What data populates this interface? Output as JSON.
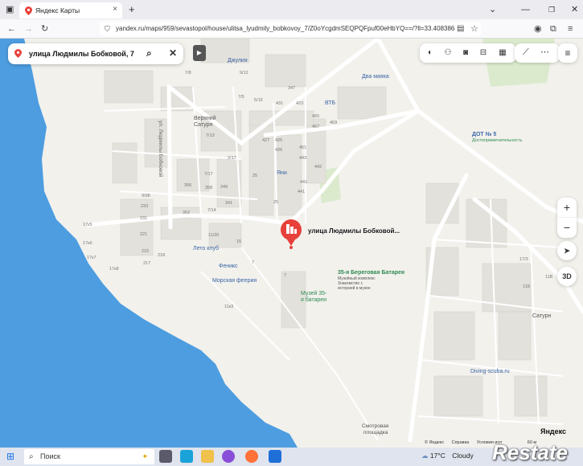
{
  "browser": {
    "tab_title": "Яндекс Карты",
    "new_tab": "+",
    "url": "yandex.ru/maps/959/sevastopol/house/ulitsa_lyudmily_bobkovoy_7/Z0oYcgdmSEQPQFpuf00eHbYQ==/?ll=33.408386",
    "window_controls": [
      "⌄",
      "—",
      "❐",
      "✕"
    ]
  },
  "search": {
    "query": "улица Людмилы Бобковой, 7",
    "pin_color": "#e8403a"
  },
  "map": {
    "selected_address": "улица Людмилы Бобковой...",
    "street_label": "ул. Людмилы Бобковой",
    "districts": [
      "Верхний",
      "Сатурн"
    ],
    "district_right": "Сатурн",
    "pois": [
      {
        "name": "Джулия"
      },
      {
        "name": "Два маяка"
      },
      {
        "name": "ВТБ"
      },
      {
        "name": "Яни"
      },
      {
        "name": "Лето клуб"
      },
      {
        "name": "Феникс"
      },
      {
        "name": "Морская феерия"
      },
      {
        "name": "ДОТ № 5",
        "sub": "Достопримечательность"
      },
      {
        "name": "35-я Береговая Батарея",
        "sub1": "Музейный комплекс",
        "sub2": "Знакомство с",
        "sub3": "историей в музее"
      },
      {
        "name": "Музей 35-",
        "name2": "я батареи"
      },
      {
        "name": "Diving-scuba.ru"
      },
      {
        "name": "Смотровая",
        "name2": "площадка"
      }
    ],
    "house_numbers": [
      "7/8",
      "9/12",
      "347",
      "431",
      "7/5",
      "423",
      "5/15",
      "465",
      "467",
      "469",
      "7/13",
      "427",
      "425",
      "426",
      "451",
      "2/17",
      "443",
      "25",
      "442",
      "441",
      "25",
      "7/17",
      "356",
      "358",
      "349",
      "441",
      "352",
      "7/14",
      "341",
      "9/98",
      "233",
      "231",
      "221",
      "17к5",
      "17к6",
      "17к7",
      "17к8",
      "215",
      "217",
      "218",
      "11/20",
      "15",
      "7",
      "11к3",
      "7",
      "17/3",
      "11Б",
      "11В"
    ],
    "accent": "#e8403a",
    "water": "#4d9de0"
  },
  "controls": {
    "zoom_in": "+",
    "zoom_out": "−",
    "location": "➤",
    "three_d": "3D"
  },
  "footer": {
    "yandex": "© Яндекс",
    "help": "Справка",
    "terms": "Условия исп",
    "scale": "60 м",
    "logo": "Яндекс"
  },
  "taskbar": {
    "search_placeholder": "Поиск",
    "weather_temp": "17°C",
    "weather_text": "Cloudy",
    "watermark": "Restate"
  }
}
